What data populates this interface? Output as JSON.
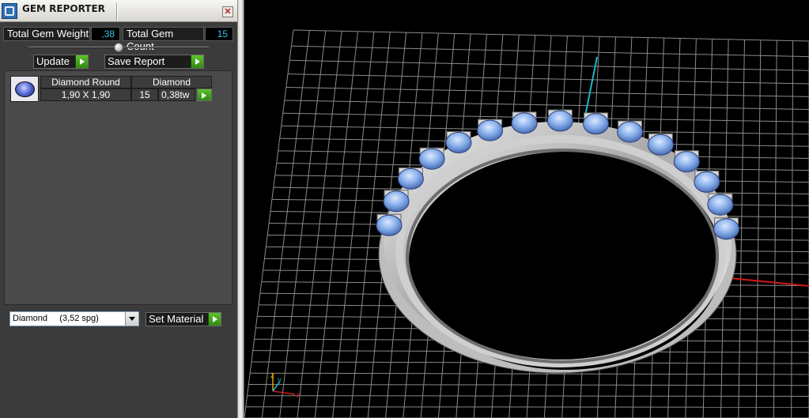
{
  "window": {
    "title": "GEM REPORTER",
    "close": "✕"
  },
  "stats": {
    "weight_label": "Total Gem Weight",
    "weight_value": ",38",
    "count_label": "Total Gem Count",
    "count_value": "15"
  },
  "toolbar": {
    "update_label": "Update",
    "save_report_label": "Save Report"
  },
  "gem_table": {
    "header_name": "Diamond Round",
    "header_material": "Diamond",
    "rows": [
      {
        "size": "1,90 X 1,90",
        "count": "15",
        "weight": "0,38tw"
      }
    ]
  },
  "material": {
    "selected": "Diamond     (3,52 spg)",
    "set_label": "Set Material"
  },
  "viewport": {
    "axis_z": "z",
    "axis_y": "y",
    "axis_x": "x",
    "colors": {
      "grid": "#8a8a8a",
      "x_axis": "#d01818",
      "y_axis": "#18b8c8",
      "metal": "#c8c8c8",
      "stone": "#7fa8e8"
    }
  }
}
